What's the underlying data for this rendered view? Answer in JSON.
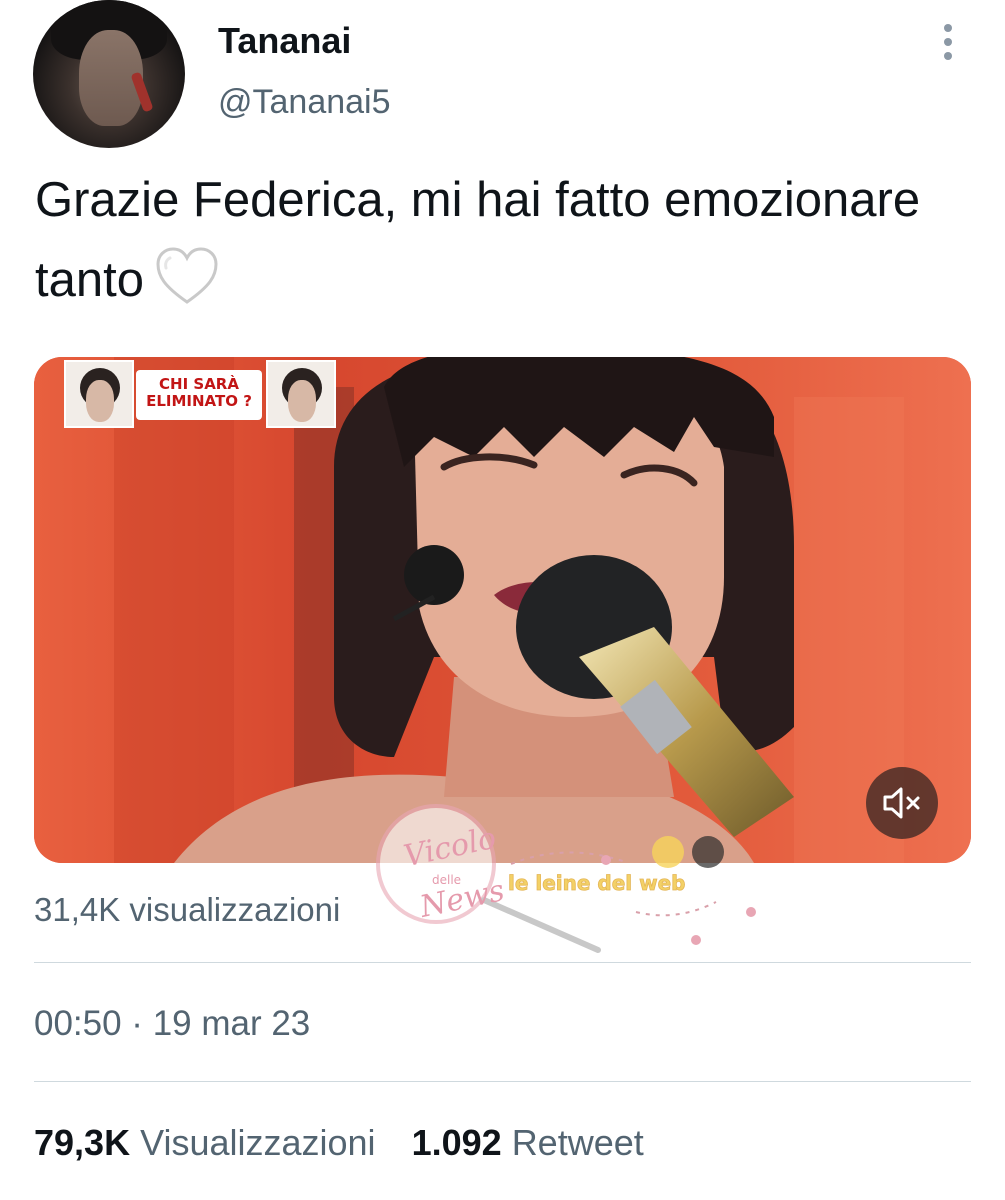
{
  "author": {
    "name": "Tananai",
    "handle": "@Tananai5"
  },
  "tweet": {
    "text": "Grazie Federica, mi hai fatto emozionare tanto",
    "emoji": "white-heart"
  },
  "media": {
    "overlay_label_line1": "CHI SARÀ",
    "overlay_label_line2": "ELIMINATO ?",
    "mute_icon": "speaker-muted-icon",
    "view_count": "31,4K visualizzazioni"
  },
  "watermark": {
    "brand": "Vicolo delle News",
    "brand_line1": "Vicolo",
    "brand_line2": "delle",
    "brand_line3": "News",
    "tagline": "le leine del web"
  },
  "meta": {
    "timestamp": "00:50 · 19 mar 23"
  },
  "stats": {
    "views_value": "79,3K",
    "views_label": "Visualizzazioni",
    "retweets_value": "1.092",
    "retweets_label": "Retweet"
  },
  "colors": {
    "text_primary": "#0f1419",
    "text_secondary": "#536471",
    "divider": "#cfd9de",
    "video_background": "#e2553c"
  }
}
